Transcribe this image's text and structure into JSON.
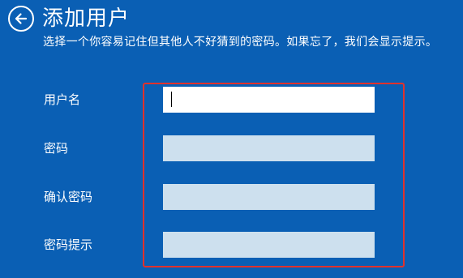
{
  "header": {
    "back_icon": "back-arrow-icon",
    "title": "添加用户"
  },
  "subtitle": "选择一个你容易记住但其他人不好猜到的密码。如果忘了，我们会显示提示。",
  "form": {
    "username": {
      "label": "用户名",
      "value": ""
    },
    "password": {
      "label": "密码",
      "value": ""
    },
    "confirm_password": {
      "label": "确认密码",
      "value": ""
    },
    "password_hint": {
      "label": "密码提示",
      "value": ""
    }
  },
  "colors": {
    "background": "#0a5fb4",
    "field_active": "#ffffff",
    "field_inactive": "#cde0ee",
    "highlight_border": "#e0322c"
  }
}
